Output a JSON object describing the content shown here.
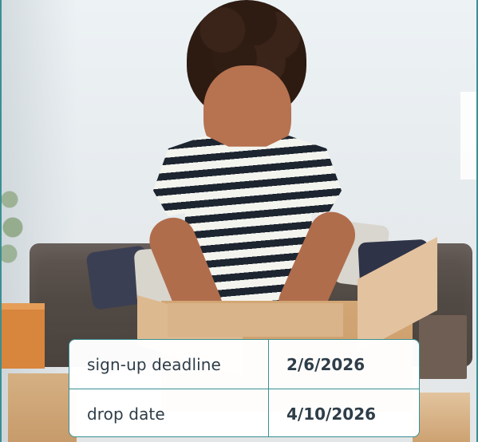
{
  "details": {
    "rows": [
      {
        "label": "sign-up deadline",
        "value": "2/6/2026"
      },
      {
        "label": "drop date",
        "value": "4/10/2026"
      }
    ]
  },
  "style": {
    "accent_color": "#3a8f93",
    "text_color": "#2e3d48"
  }
}
